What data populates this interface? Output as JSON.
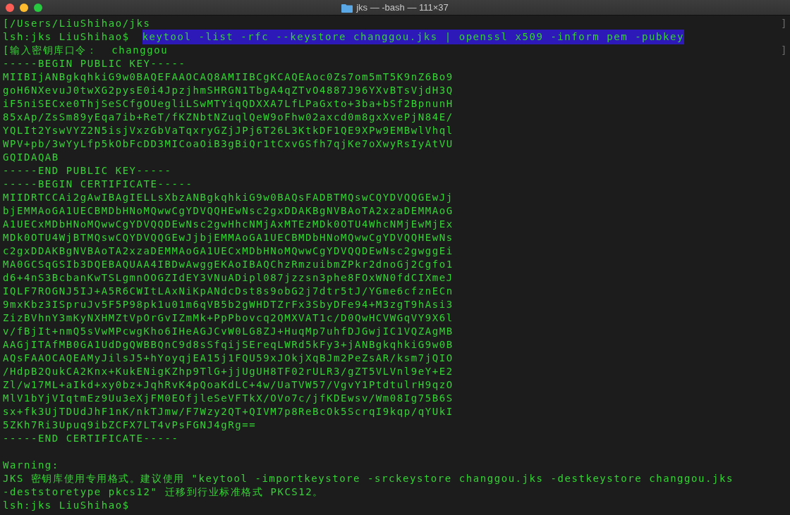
{
  "window": {
    "title": "jks — -bash — 111×37"
  },
  "lines": [
    {
      "kind": "marked",
      "text": "[/Users/LiuShihao/jks",
      "end_mark": "]"
    },
    {
      "kind": "prompt",
      "prompt": "lsh:jks LiuShihao$",
      "command": {
        "text": "keytool -list -rfc --keystore changgou.jks | openssl x509 -inform pem -pubkey",
        "selected": true
      }
    },
    {
      "kind": "marked",
      "text": "[输入密钥库口令：  changgou",
      "end_mark": "]"
    },
    {
      "kind": "text",
      "text": "-----BEGIN PUBLIC KEY-----"
    },
    {
      "kind": "text",
      "text": "MIIBIjANBgkqhkiG9w0BAQEFAAOCAQ8AMIIBCgKCAQEAoc0Zs7om5mT5K9nZ6Bo9"
    },
    {
      "kind": "text",
      "text": "goH6NXevuJ0twXG2pysE0i4JpzjhmSHRGN1TbgA4qZTvO4887J96YXvBTsVjdH3Q"
    },
    {
      "kind": "text",
      "text": "iF5niSECxe0ThjSeSCfgOUegliLSwMTYiqQDXXA7LfLPaGxto+3ba+bSf2BpnunH"
    },
    {
      "kind": "text",
      "text": "85xAp/ZsSm89yEqa7ib+ReT/fKZNbtNZuqlQeW9oFhw02axcd0m8gxXvePjN84E/"
    },
    {
      "kind": "text",
      "text": "YQLIt2YswVYZ2N5isjVxzGbVaTqxryGZjJPj6T26L3KtkDF1QE9XPw9EMBwlVhql"
    },
    {
      "kind": "text",
      "text": "WPV+pb/3wYyLfp5kObFcDD3MICoaOiB3gBiQr1tCxvGSfh7qjKe7oXwyRsIyAtVU"
    },
    {
      "kind": "text",
      "text": "GQIDAQAB"
    },
    {
      "kind": "text",
      "text": "-----END PUBLIC KEY-----"
    },
    {
      "kind": "text",
      "text": "-----BEGIN CERTIFICATE-----"
    },
    {
      "kind": "text",
      "text": "MIIDRTCCAi2gAwIBAgIELLsXbzANBgkqhkiG9w0BAQsFADBTMQswCQYDVQQGEwJj"
    },
    {
      "kind": "text",
      "text": "bjEMMAoGA1UECBMDbHNoMQwwCgYDVQQHEwNsc2gxDDAKBgNVBAoTA2xzaDEMMAoG"
    },
    {
      "kind": "text",
      "text": "A1UECxMDbHNoMQwwCgYDVQQDEwNsc2gwHhcNMjAxMTEzMDk0OTU4WhcNMjEwMjEx"
    },
    {
      "kind": "text",
      "text": "MDk0OTU4WjBTMQswCQYDVQQGEwJjbjEMMAoGA1UECBMDbHNoMQwwCgYDVQQHEwNs"
    },
    {
      "kind": "text",
      "text": "c2gxDDAKBgNVBAoTA2xzaDEMMAoGA1UECxMDbHNoMQwwCgYDVQQDEwNsc2gwggEi"
    },
    {
      "kind": "text",
      "text": "MA0GCSqGSIb3DQEBAQUAA4IBDwAwggEKAoIBAQChzRmzuibmZPkr2dnoGj2Cgfo1"
    },
    {
      "kind": "text",
      "text": "d6+4nS3BcbanKwTSLgmnOOGZIdEY3VNuADipl087jzzsn3phe8FOxWN0fdCIXmeJ"
    },
    {
      "kind": "text",
      "text": "IQLF7ROGNJ5IJ+A5R6CWItLAxNiKpANdcDst8s9obG2j7dtr5tJ/YGme6cfznECn"
    },
    {
      "kind": "text",
      "text": "9mxKbz3ISpruJv5F5P98pk1u01m6qVB5b2gWHDTZrFx3SbyDFe94+M3zgT9hAsi3"
    },
    {
      "kind": "text",
      "text": "ZizBVhnY3mKyNXHMZtVpOrGvIZmMk+PpPbovcq2QMXVAT1c/D0QwHCVWGqVY9X6l"
    },
    {
      "kind": "text",
      "text": "v/fBjIt+nmQ5sVwMPcwgKho6IHeAGJCvW0LG8ZJ+HuqMp7uhfDJGwjIC1VQZAgMB"
    },
    {
      "kind": "text",
      "text": "AAGjITAfMB0GA1UdDgQWBBQnC9d8sSfqijSEreqLWRd5kFy3+jANBgkqhkiG9w0B"
    },
    {
      "kind": "text",
      "text": "AQsFAAOCAQEAMyJilsJ5+hYoyqjEA15j1FQU59xJOkjXqBJm2PeZsAR/ksm7jQIO"
    },
    {
      "kind": "text",
      "text": "/HdpB2QukCA2Knx+KukENigKZhp9TlG+jjUgUH8TF02rULR3/gZT5VLVnl9eY+E2"
    },
    {
      "kind": "text",
      "text": "Zl/w17ML+aIkd+xy0bz+JqhRvK4pQoaKdLC+4w/UaTVW57/VgvY1PtdtulrH9qzO"
    },
    {
      "kind": "text",
      "text": "MlV1bYjVIqtmEz9Uu3eXjFM0EOfjleSeVFTkX/OVo7c/jfKDEwsv/Wm08Ig75B6S"
    },
    {
      "kind": "text",
      "text": "sx+fk3UjTDUdJhF1nK/nkTJmw/F7Wzy2QT+QIVM7p8ReBcOk5ScrqI9kqp/qYUkI"
    },
    {
      "kind": "text",
      "text": "5ZKh7Ri3Upuq9ibZCFX7LT4vPsFGNJ4gRg=="
    },
    {
      "kind": "text",
      "text": "-----END CERTIFICATE-----"
    },
    {
      "kind": "blank"
    },
    {
      "kind": "text",
      "text": "Warning:"
    },
    {
      "kind": "text",
      "text": "JKS 密钥库使用专用格式。建议使用 \"keytool -importkeystore -srckeystore changgou.jks -destkeystore changgou.jks"
    },
    {
      "kind": "text",
      "text": "-deststoretype pkcs12\" 迁移到行业标准格式 PKCS12。"
    },
    {
      "kind": "prompt",
      "prompt": "lsh:jks LiuShihao$"
    }
  ]
}
